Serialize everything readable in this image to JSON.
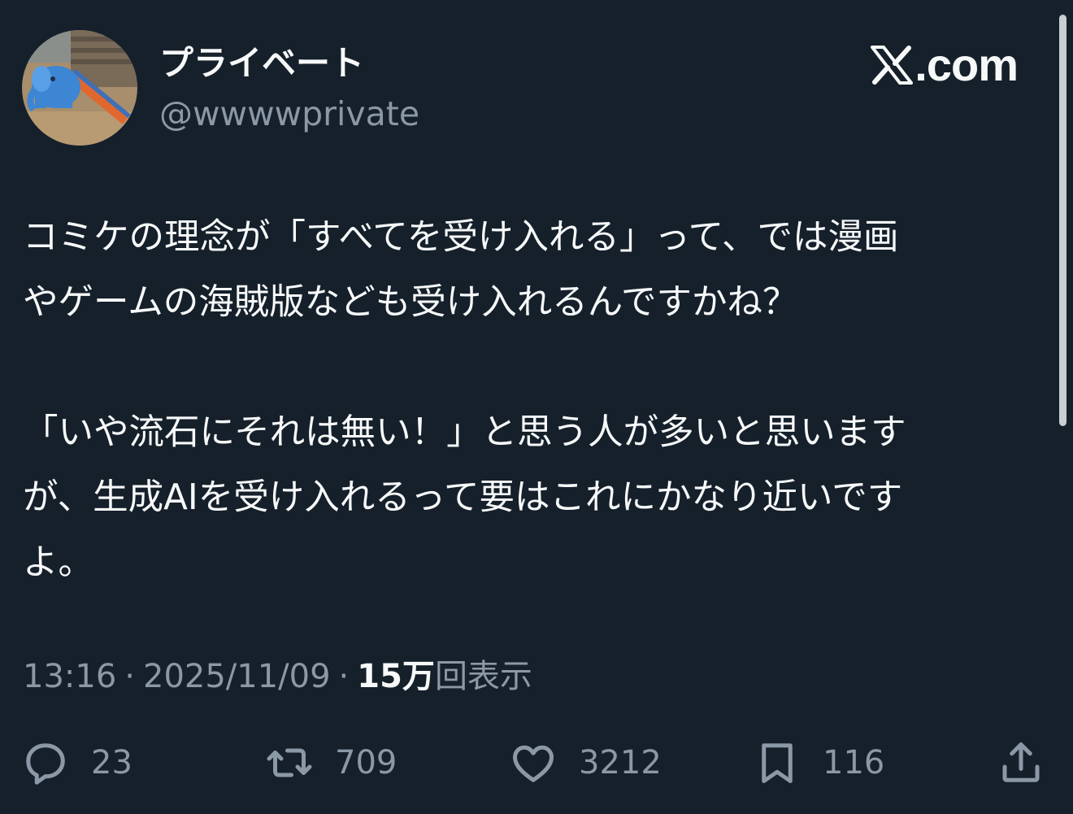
{
  "author": {
    "display_name": "プライベート",
    "handle": "@wwwwprivate",
    "avatar_icon": "elephant-slide-photo"
  },
  "brand": {
    "label": ".com",
    "icon": "x-logo-icon"
  },
  "tweet": {
    "paragraph_1": "コミケの理念が「すべてを受け入れる」って、では漫画\nやゲームの海賊版なども受け入れるんですかね？",
    "paragraph_2": "「いや流石にそれは無い！」と思う人が多いと思います\nが、生成AIを受け入れるって要はこれにかなり近いです\nよ。"
  },
  "meta": {
    "time": "13:16",
    "separator": "·",
    "date": "2025/11/09",
    "views_count": "15万",
    "views_label": "回表示"
  },
  "actions": {
    "reply": {
      "icon": "reply-icon",
      "count": "23"
    },
    "repost": {
      "icon": "repost-icon",
      "count": "709"
    },
    "like": {
      "icon": "heart-icon",
      "count": "3212"
    },
    "bookmark": {
      "icon": "bookmark-icon",
      "count": "116"
    },
    "share": {
      "icon": "share-icon"
    }
  },
  "colors": {
    "background": "#15202b",
    "text_primary": "#f7f9f9",
    "text_secondary": "#8b98a5"
  }
}
